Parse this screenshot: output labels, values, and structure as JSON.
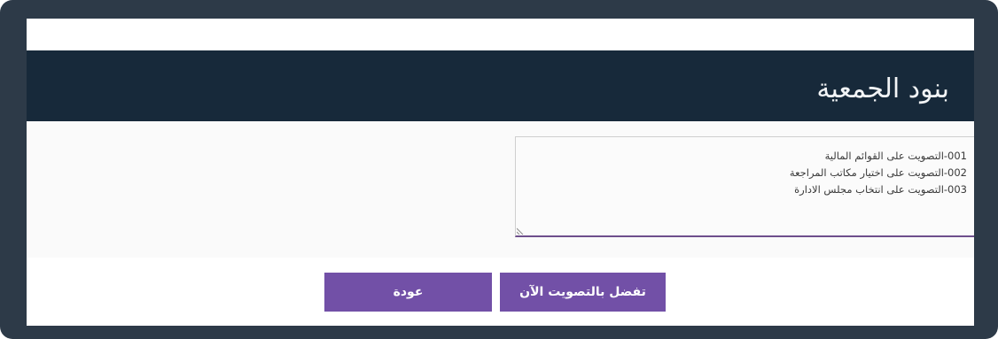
{
  "header": {
    "title": "بنود الجمعية"
  },
  "agenda": {
    "items": [
      "001-التصويت على القوائم المالية",
      "002-التصويت على اختيار مكاتب المراجعة",
      "003-التصويت على انتخاب مجلس الادارة"
    ]
  },
  "actions": {
    "vote_label": "تفضل بالتصويت الآن",
    "back_label": "عودة"
  },
  "colors": {
    "backdrop": "#2d3a48",
    "header": "#17293a",
    "button": "#7250a7",
    "textarea_underline": "#6e4f8c"
  },
  "icons": {
    "resize_grip": "resize-grip-icon"
  }
}
